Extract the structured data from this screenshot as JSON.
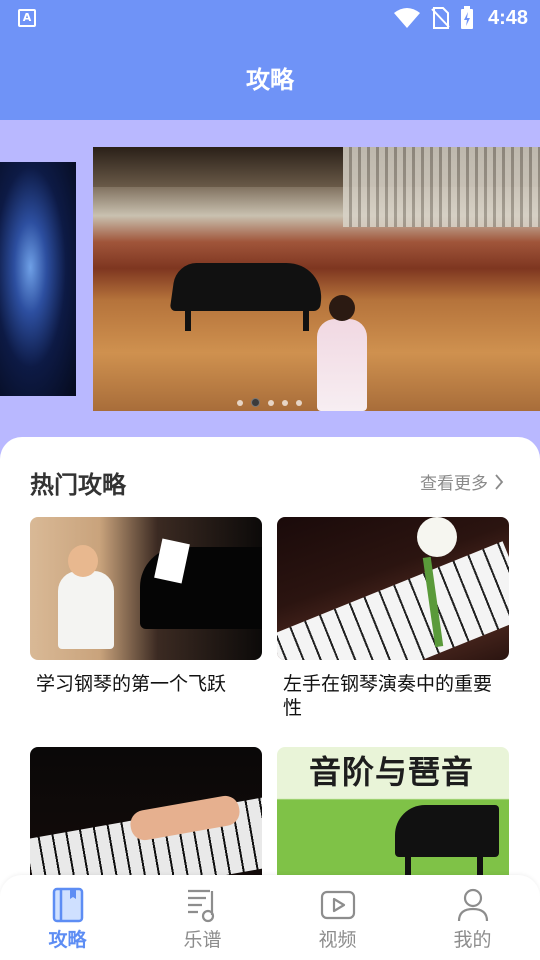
{
  "status_bar": {
    "time": "4:48",
    "app_badge": "A"
  },
  "header": {
    "title": "攻略"
  },
  "banner": {
    "dot_count": 5,
    "active_dot": 1
  },
  "section": {
    "title": "热门攻略",
    "more_label": "查看更多"
  },
  "articles": [
    {
      "title": "学习钢琴的第一个飞跃"
    },
    {
      "title": "左手在钢琴演奏中的重要性"
    },
    {
      "title": ""
    },
    {
      "title": "",
      "cover_text": "音阶与琶音"
    }
  ],
  "bottom_nav": [
    {
      "label": "攻略",
      "icon": "book-icon",
      "active": true
    },
    {
      "label": "乐谱",
      "icon": "music-score-icon",
      "active": false
    },
    {
      "label": "视频",
      "icon": "video-play-icon",
      "active": false
    },
    {
      "label": "我的",
      "icon": "person-icon",
      "active": false
    }
  ],
  "colors": {
    "primary": "#6f93f7",
    "banner_bg": "#b9b8ff",
    "nav_active": "#5d8df4",
    "nav_inactive": "#8d8d8d"
  }
}
